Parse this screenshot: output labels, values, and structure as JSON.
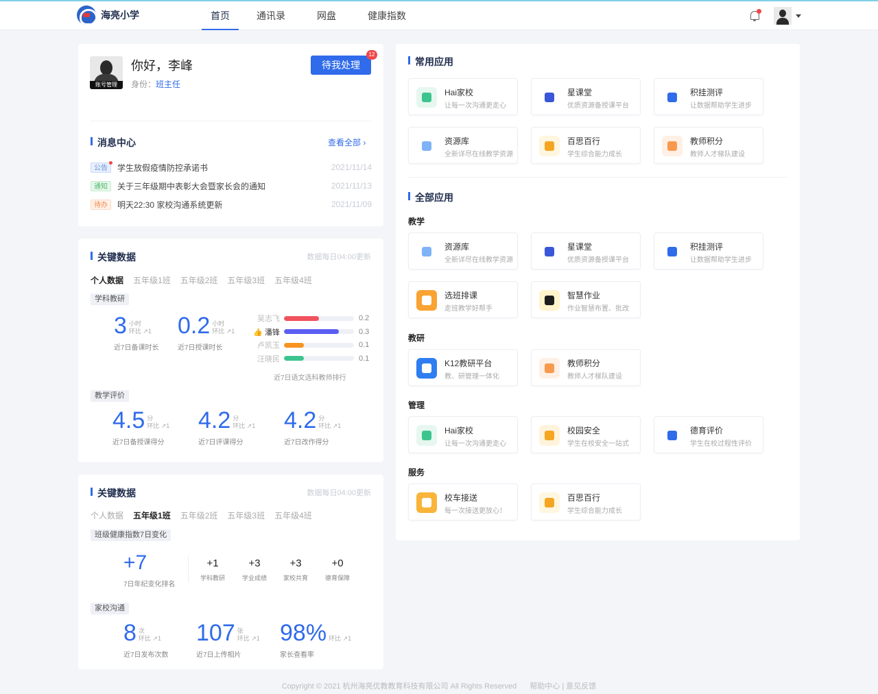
{
  "header": {
    "school_name": "海亮小学",
    "tabs": [
      "首页",
      "通讯录",
      "网盘",
      "健康指数"
    ]
  },
  "profile": {
    "greeting": "你好，李峰",
    "role_label": "身份：",
    "role_value": "班主任",
    "avatar_tag": "账号管理",
    "todo_button": "待我处理",
    "todo_count": "12"
  },
  "messages": {
    "title": "消息中心",
    "more": "查看全部",
    "items": [
      {
        "tag": "公告",
        "text": "学生放假疫情防控承诺书",
        "date": "2021/11/14"
      },
      {
        "tag": "通知",
        "text": "关于三年级期中表彰大会暨家长会的通知",
        "date": "2021/11/13"
      },
      {
        "tag": "待办",
        "text": "明天22:30 家校沟通系统更新",
        "date": "2021/11/09"
      }
    ]
  },
  "key_data_1": {
    "title": "关键数据",
    "update_note": "数据每日04:00更新",
    "tabs": [
      "个人数据",
      "五年级1班",
      "五年级2班",
      "五年级3班",
      "五年级4班"
    ],
    "pill_1": "学科教研",
    "stats_1": [
      {
        "num": "3",
        "unit_top": "小时",
        "unit_bot": "环比 ↗1",
        "label": "近7日备课时长"
      },
      {
        "num": "0.2",
        "unit_top": "小时",
        "unit_bot": "环比 ↗1",
        "label": "近7日授课时长"
      }
    ],
    "ranking": [
      {
        "name": "吴志飞",
        "value": "0.2",
        "fill": 0.5
      },
      {
        "name": "👍 潘锋",
        "value": "0.3",
        "fill": 0.78
      },
      {
        "name": "卢凯玉",
        "value": "0.1",
        "fill": 0.28
      },
      {
        "name": "汪晓民",
        "value": "0.1",
        "fill": 0.28
      }
    ],
    "ranking_caption": "近7日语文选科教师排行",
    "pill_2": "教学评价",
    "stats_2": [
      {
        "num": "4.5",
        "unit_top": "分",
        "unit_bot": "环比 ↗1",
        "label": "近7日备授课得分"
      },
      {
        "num": "4.2",
        "unit_top": "分",
        "unit_bot": "环比 ↗1",
        "label": "近7日评课得分"
      },
      {
        "num": "4.2",
        "unit_top": "分",
        "unit_bot": "环比 ↗1",
        "label": "近7日改作得分"
      }
    ]
  },
  "key_data_2": {
    "title": "关键数据",
    "update_note": "数据每日04:00更新",
    "tabs": [
      "个人数据",
      "五年级1班",
      "五年级2班",
      "五年级3班",
      "五年级4班"
    ],
    "pill_1": "班级健康指数7日变化",
    "big": {
      "num": "+7",
      "label": "7日年纪变化排名"
    },
    "small": [
      {
        "num": "+1",
        "label": "学科教研"
      },
      {
        "num": "+3",
        "label": "学业成绩"
      },
      {
        "num": "+3",
        "label": "家校共育"
      },
      {
        "num": "+0",
        "label": "德育保障"
      }
    ],
    "pill_2": "家校沟通",
    "stats": [
      {
        "num": "8",
        "unit_top": "次",
        "unit_bot": "环比 ↗1",
        "label": "近7日发布次数"
      },
      {
        "num": "107",
        "unit_top": "张",
        "unit_bot": "环比 ↗1",
        "label": "近7日上传相片"
      },
      {
        "num": "98%",
        "unit_top": "",
        "unit_bot": "环比 ↗1",
        "label": "家长查看率"
      }
    ]
  },
  "common_apps": {
    "title": "常用应用",
    "items": [
      {
        "name": "Hai家校",
        "desc": "让每一次沟通更走心",
        "color": "#e6f7ef",
        "inner": "#3cc48f"
      },
      {
        "name": "星课堂",
        "desc": "优质资源备授课平台",
        "color": "#ffffff",
        "inner": "#3957d8"
      },
      {
        "name": "积挂测评",
        "desc": "让数据帮助学生进步",
        "color": "#ffffff",
        "inner": "#2f6bea"
      },
      {
        "name": "资源库",
        "desc": "全新详尽在线教学资源",
        "color": "#ffffff",
        "inner": "#7fb3f7"
      },
      {
        "name": "百思百行",
        "desc": "学生综合能力成长",
        "color": "#fff6e0",
        "inner": "#f4a623"
      },
      {
        "name": "教师积分",
        "desc": "教师人才梯队建设",
        "color": "#fff0e6",
        "inner": "#f79a4d"
      }
    ]
  },
  "all_apps": {
    "title": "全部应用",
    "groups": [
      {
        "name": "教学",
        "items": [
          {
            "name": "资源库",
            "desc": "全新详尽在线教学资源",
            "color": "#ffffff",
            "inner": "#7fb3f7"
          },
          {
            "name": "星课堂",
            "desc": "优质资源备授课平台",
            "color": "#ffffff",
            "inner": "#3957d8"
          },
          {
            "name": "积挂测评",
            "desc": "让数据帮助学生进步",
            "color": "#ffffff",
            "inner": "#2f6bea"
          },
          {
            "name": "选班排课",
            "desc": "走班教学好帮手",
            "color": "#f9a333",
            "inner": "#ffffff"
          },
          {
            "name": "智慧作业",
            "desc": "作业智慧布置、批改",
            "color": "#fff3cc",
            "inner": "#1c1c1c"
          }
        ]
      },
      {
        "name": "教研",
        "items": [
          {
            "name": "K12教研平台",
            "desc": "教、研管理一体化",
            "color": "#2f7df0",
            "inner": "#ffffff"
          },
          {
            "name": "教师积分",
            "desc": "教师人才梯队建设",
            "color": "#fff0e6",
            "inner": "#f79a4d"
          }
        ]
      },
      {
        "name": "管理",
        "items": [
          {
            "name": "Hai家校",
            "desc": "让每一次沟通更走心",
            "color": "#e6f7ef",
            "inner": "#3cc48f"
          },
          {
            "name": "校园安全",
            "desc": "学生在校安全一站式",
            "color": "#fff3dc",
            "inner": "#f5a623"
          },
          {
            "name": "德育评价",
            "desc": "学生在校过程性评价",
            "color": "#ffffff",
            "inner": "#2f6bea"
          }
        ]
      },
      {
        "name": "服务",
        "items": [
          {
            "name": "校车接送",
            "desc": "每一次接送更放心！",
            "color": "#f9b43a",
            "inner": "#ffffff"
          },
          {
            "name": "百思百行",
            "desc": "学生综合能力成长",
            "color": "#fff6e0",
            "inner": "#f4a623"
          }
        ]
      }
    ]
  },
  "footer": {
    "copyright": "Copyright © 2021 杭州海亮优教教育科技有限公司  All Rights Reserved",
    "links": "帮助中心 | 意见反馈"
  }
}
